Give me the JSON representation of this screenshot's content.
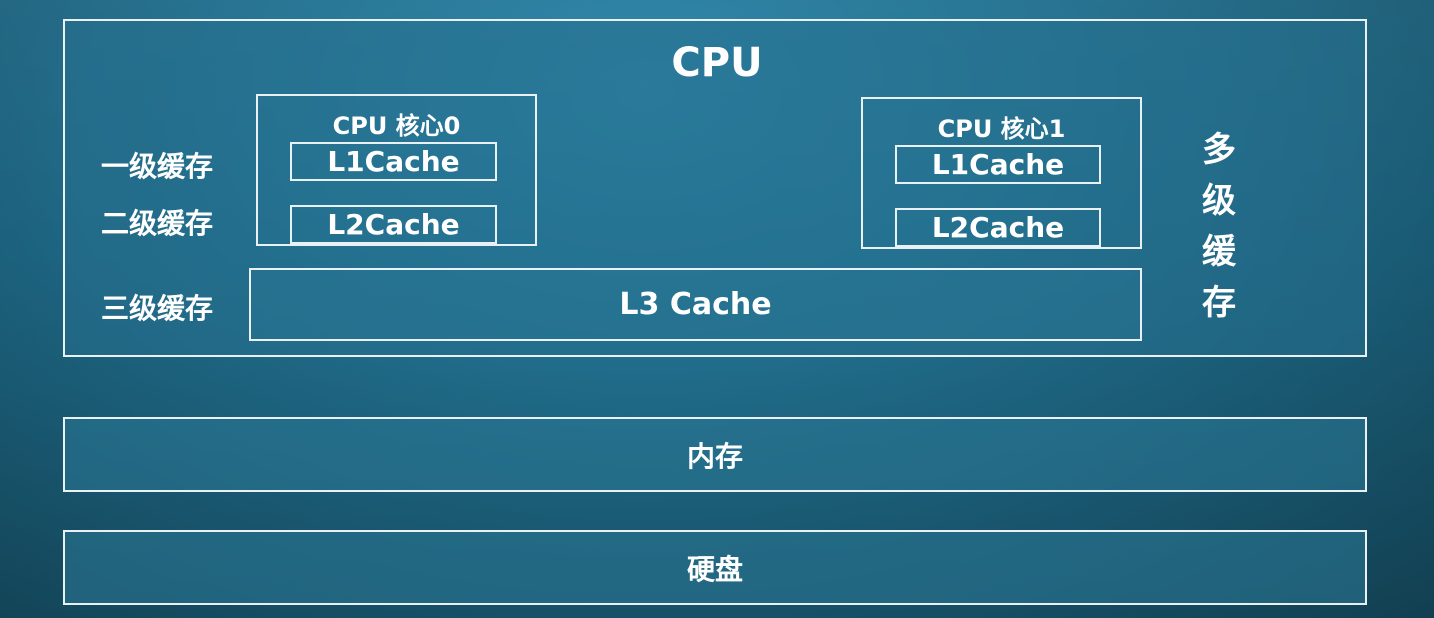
{
  "cpu": {
    "title": "CPU",
    "cores": [
      {
        "title": "CPU 核心0",
        "l1": "L1Cache",
        "l2": "L2Cache"
      },
      {
        "title": "CPU 核心1",
        "l1": "L1Cache",
        "l2": "L2Cache"
      }
    ],
    "l3": "L3 Cache"
  },
  "labels": {
    "level1": "一级缓存",
    "level2": "二级缓存",
    "level3": "三级缓存",
    "multi_level": "多级缓存"
  },
  "memory": "内存",
  "disk": "硬盘"
}
